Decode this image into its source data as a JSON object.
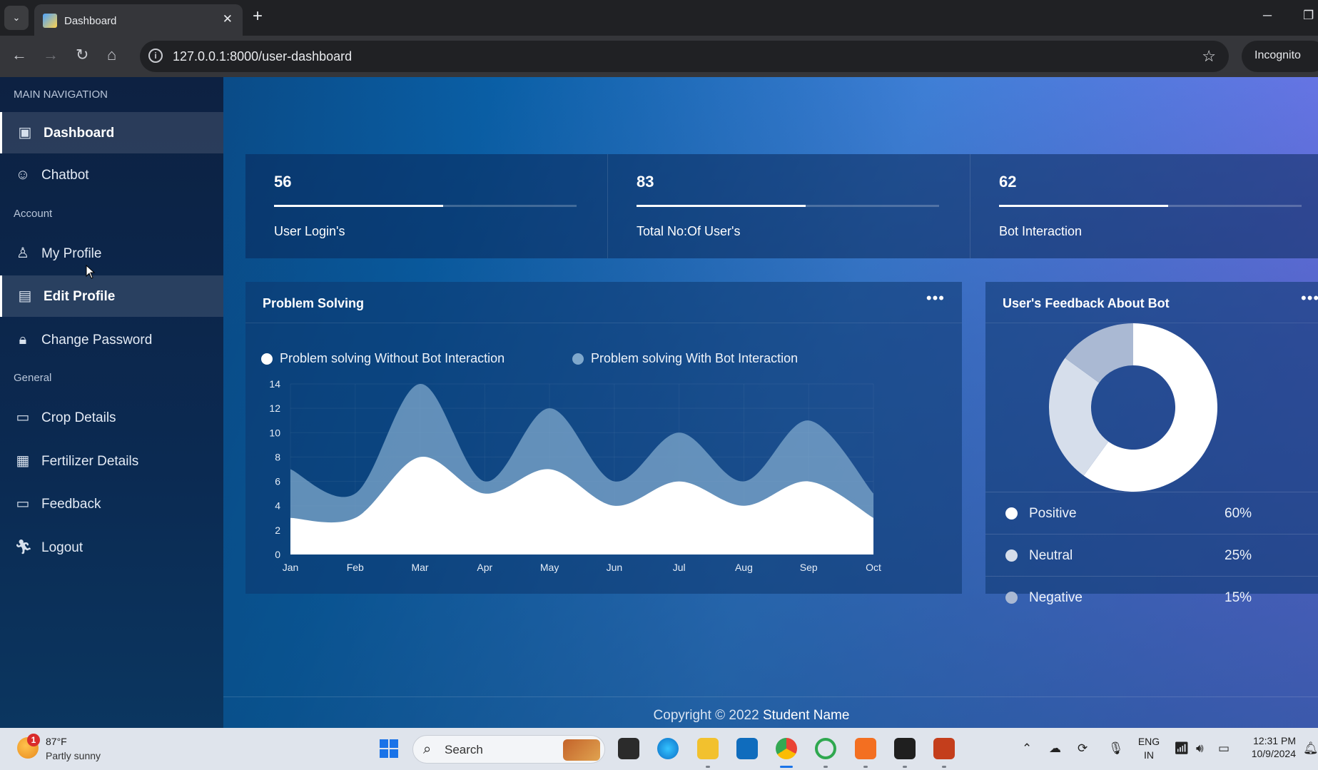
{
  "browser": {
    "tab_title": "Dashboard",
    "url": "127.0.0.1:8000/user-dashboard",
    "incognito_label": "Incognito"
  },
  "sidebar": {
    "section_main": "MAIN NAVIGATION",
    "section_account": "Account",
    "section_general": "General",
    "items": [
      {
        "label": "Dashboard",
        "icon": "dashboard-icon",
        "active": true
      },
      {
        "label": "Chatbot",
        "icon": "chatbot-icon",
        "active": false
      },
      {
        "label": "My Profile",
        "icon": "user-icon",
        "active": false
      },
      {
        "label": "Edit Profile",
        "icon": "id-card-icon",
        "active": true
      },
      {
        "label": "Change Password",
        "icon": "lock-icon",
        "active": false
      },
      {
        "label": "Crop Details",
        "icon": "card-icon",
        "active": false
      },
      {
        "label": "Fertilizer Details",
        "icon": "medkit-icon",
        "active": false
      },
      {
        "label": "Feedback",
        "icon": "card-icon",
        "active": false
      },
      {
        "label": "Logout",
        "icon": "run-icon",
        "active": false
      }
    ]
  },
  "stats": [
    {
      "value": "56",
      "caption": "User Login's",
      "progress": 0.56
    },
    {
      "value": "83",
      "caption": "Total No:Of User's",
      "progress": 0.56
    },
    {
      "value": "62",
      "caption": "Bot Interaction",
      "progress": 0.56
    }
  ],
  "problem_card": {
    "title": "Problem Solving",
    "menu_icon": "more-dots-icon"
  },
  "feedback_card": {
    "title": "User's Feedback About Bot",
    "menu_icon": "more-dots-icon",
    "rows": [
      {
        "name": "Positive",
        "pct": "60%",
        "color": "#ffffff"
      },
      {
        "name": "Neutral",
        "pct": "25%",
        "color": "#d6deeb"
      },
      {
        "name": "Negative",
        "pct": "15%",
        "color": "#aab9d3"
      }
    ]
  },
  "chart_data": [
    {
      "type": "area",
      "categories": [
        "Jan",
        "Feb",
        "Mar",
        "Apr",
        "May",
        "Jun",
        "Jul",
        "Aug",
        "Sep",
        "Oct"
      ],
      "series": [
        {
          "name": "Problem solving Without Bot Interaction",
          "values": [
            3,
            3,
            8,
            5,
            7,
            4,
            6,
            4,
            6,
            3
          ],
          "color": "#ffffff"
        },
        {
          "name": "Problem solving With Bot Interaction",
          "values": [
            7,
            5,
            14,
            6,
            12,
            6,
            10,
            6,
            11,
            5
          ],
          "color": "#7fa8cc"
        }
      ],
      "y_ticks": [
        "0",
        "2",
        "4",
        "6",
        "8",
        "10",
        "12",
        "14"
      ],
      "ylim": [
        0,
        14
      ],
      "grid": true,
      "legend": "top-left"
    },
    {
      "type": "pie",
      "labels": [
        "Positive",
        "Neutral",
        "Negative"
      ],
      "values": [
        60,
        25,
        15
      ],
      "colors": [
        "#ffffff",
        "#d6deeb",
        "#aab9d3"
      ],
      "donut": true
    }
  ],
  "footer": {
    "copyright": "Copyright © 2022",
    "name": "Student Name"
  },
  "taskbar": {
    "temp": "87°F",
    "weather": "Partly sunny",
    "weather_badge": "1",
    "search_placeholder": "Search",
    "lang_top": "ENG",
    "lang_bottom": "IN",
    "time": "12:31 PM",
    "date": "10/9/2024"
  }
}
